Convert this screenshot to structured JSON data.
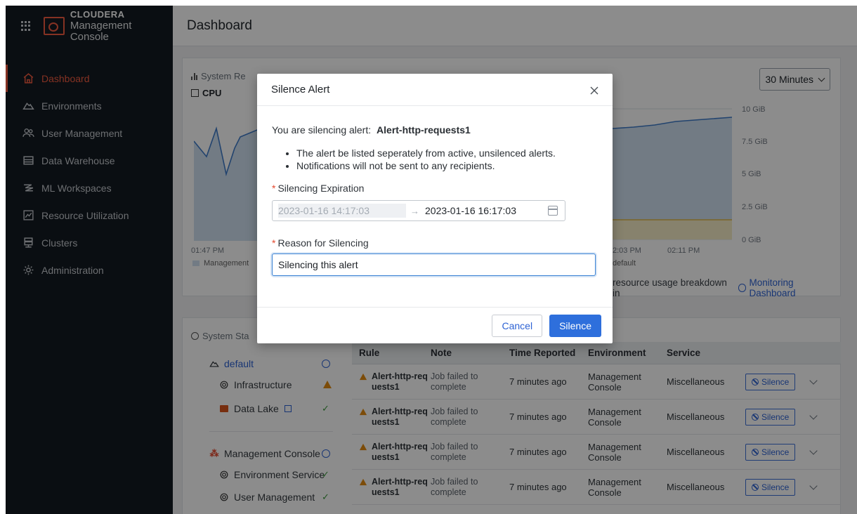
{
  "brand": {
    "line1": "CLOUDERA",
    "line2": "Management Console"
  },
  "nav": [
    {
      "label": "Dashboard",
      "icon": "home-icon",
      "active": true
    },
    {
      "label": "Environments",
      "icon": "cloud-icon"
    },
    {
      "label": "User Management",
      "icon": "users-icon"
    },
    {
      "label": "Data Warehouse",
      "icon": "warehouse-icon"
    },
    {
      "label": "ML Workspaces",
      "icon": "ml-icon"
    },
    {
      "label": "Resource Utilization",
      "icon": "resource-icon"
    },
    {
      "label": "Clusters",
      "icon": "clusters-icon"
    },
    {
      "label": "Administration",
      "icon": "gear-icon"
    }
  ],
  "page": {
    "title": "Dashboard"
  },
  "resources": {
    "title": "System Re",
    "cpu_label": "CPU",
    "range": "30 Minutes",
    "y_ticks": [
      "10 GiB",
      "7.5 GiB",
      "5 GiB",
      "2.5 GiB",
      "0 GiB"
    ],
    "x_ticks_left": [
      "01:47 PM"
    ],
    "x_ticks_right": [
      "2:03 PM",
      "02:11 PM"
    ],
    "legend_left": "Management",
    "legend_right": "default",
    "breakdown_prefix": "resource usage breakdown in",
    "breakdown_link": "Monitoring Dashboard"
  },
  "status": {
    "title": "System Sta",
    "items": [
      {
        "label": "default",
        "kind": "group"
      },
      {
        "label": "Infrastructure",
        "kind": "warn"
      },
      {
        "label": "Data Lake",
        "kind": "ok"
      },
      {
        "label": "Management Console",
        "kind": "group"
      },
      {
        "label": "Environment Service",
        "kind": "ok"
      },
      {
        "label": "User Management",
        "kind": "ok"
      }
    ]
  },
  "table": {
    "headers": [
      "Rule",
      "Note",
      "Time Reported",
      "Environment",
      "Service"
    ],
    "rows": [
      {
        "rule": "Alert-http-requests1",
        "note": "Job failed to complete",
        "time": "7 minutes ago",
        "env": "Management Console",
        "service": "Miscellaneous",
        "action": "Silence"
      },
      {
        "rule": "Alert-http-requests1",
        "note": "Job failed to complete",
        "time": "7 minutes ago",
        "env": "Management Console",
        "service": "Miscellaneous",
        "action": "Silence"
      },
      {
        "rule": "Alert-http-requests1",
        "note": "Job failed to complete",
        "time": "7 minutes ago",
        "env": "Management Console",
        "service": "Miscellaneous",
        "action": "Silence"
      },
      {
        "rule": "Alert-http-requests1",
        "note": "Job failed to complete",
        "time": "7 minutes ago",
        "env": "Management Console",
        "service": "Miscellaneous",
        "action": "Silence"
      }
    ]
  },
  "modal": {
    "title": "Silence Alert",
    "intro_prefix": "You are silencing alert:",
    "alert_name": "Alert-http-requests1",
    "bullets": [
      "The alert be listed seperately from active, unsilenced alerts.",
      "Notifications will not be sent to any recipients."
    ],
    "expiration_label": "Silencing Expiration",
    "start": "2023-01-16 14:17:03",
    "end": "2023-01-16 16:17:03",
    "reason_label": "Reason for Silencing",
    "reason_value": "Silencing this alert",
    "cancel": "Cancel",
    "submit": "Silence"
  },
  "colors": {
    "accent": "#f35b40",
    "primary": "#2e6fdc",
    "warn": "#e28a12",
    "ok": "#3f9a40"
  }
}
